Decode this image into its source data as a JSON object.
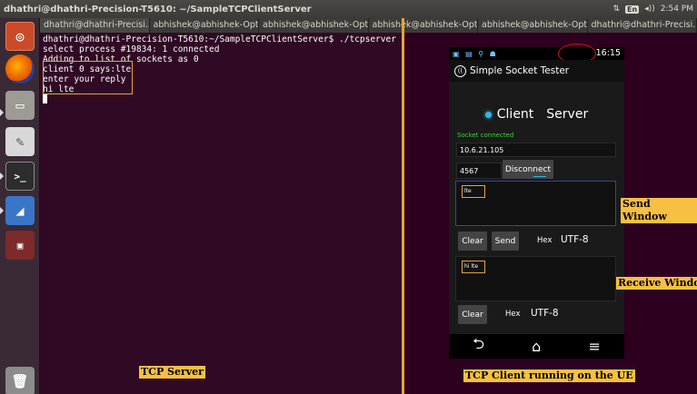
{
  "panel": {
    "title": "dhathri@dhathri-Precision-T5610: ~/SampleTCPClientServer",
    "network_icon": "⇅",
    "keyboard": "En",
    "volume": "◂))",
    "clock": "2:54 PM"
  },
  "tabs": [
    {
      "label": "dhathri@dhathri-Precisi...  ×"
    },
    {
      "label": "abhishek@abhishek-Opt...  ×"
    },
    {
      "label": "abhishek@abhishek-Opt...  ×"
    },
    {
      "label": "abhishek@abhishek-Opt...  ×"
    },
    {
      "label": "abhishek@abhishek-Opt...  ×"
    },
    {
      "label": "dhathri@dhathri-Precisi...  ×"
    }
  ],
  "terminal": {
    "lines": [
      "dhathri@dhathri-Precision-T5610:~/SampleTCPClientServer$ ./tcpserver 4567",
      "select process #19834: 1 connected",
      "Adding to list of sockets as 0",
      "client 0 says:lte",
      "enter your reply",
      "hi lte"
    ]
  },
  "captions": {
    "tcp_server": "TCP Server",
    "send_window": "Send Window",
    "receive_window": "Receive Window",
    "tcp_client": "TCP Client running on the UE"
  },
  "phone": {
    "time": "16:15",
    "app_title": "Simple Socket Tester",
    "mode_client": "Client",
    "mode_server": "Server",
    "socket_status": "Socket connected",
    "ip_address": "10.6.21.105",
    "port": "4567",
    "disconnect_label": "Disconnect",
    "send_text": "lte",
    "received_text": "hi lte",
    "clear_label": "Clear",
    "send_label": "Send",
    "hex_label": "Hex",
    "encoding": "UTF-8",
    "nav_back": "⮌",
    "nav_home": "⌂",
    "nav_menu": "≡"
  },
  "colors": {
    "terminal_bg": "#300a24",
    "highlight": "#e8a33c",
    "caption_bg": "#f8c040",
    "connected": "#3cd13c",
    "accent": "#33b5e5"
  }
}
